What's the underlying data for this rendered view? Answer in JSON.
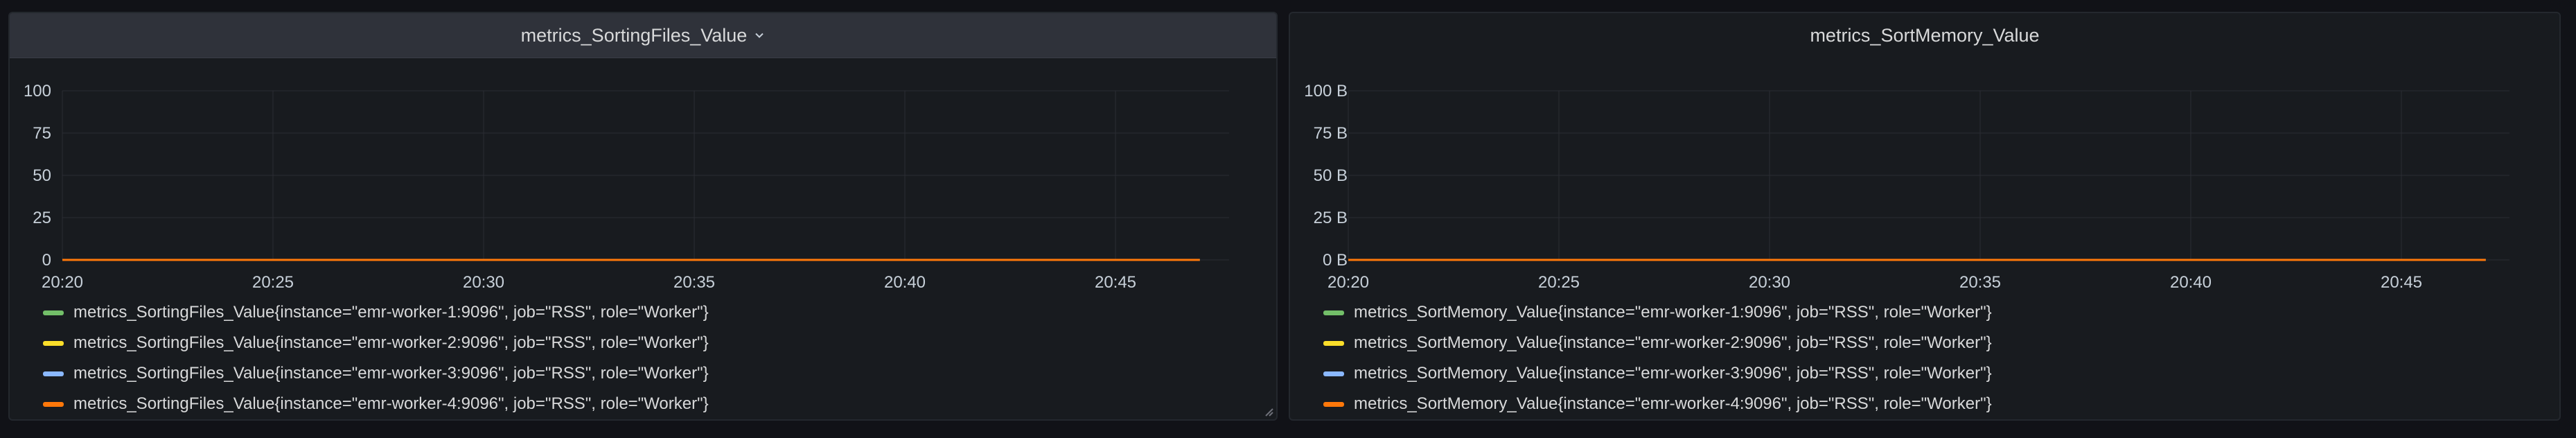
{
  "colors": {
    "background": "#111217",
    "panel": "#181b1f",
    "grid": "#2a2d33",
    "series": [
      "#73bf69",
      "#fade2a",
      "#8ab8ff",
      "#ff780a"
    ]
  },
  "panels": [
    {
      "title": "metrics_SortingFiles_Value",
      "has_menu": true,
      "legend": [
        "metrics_SortingFiles_Value{instance=\"emr-worker-1:9096\", job=\"RSS\", role=\"Worker\"}",
        "metrics_SortingFiles_Value{instance=\"emr-worker-2:9096\", job=\"RSS\", role=\"Worker\"}",
        "metrics_SortingFiles_Value{instance=\"emr-worker-3:9096\", job=\"RSS\", role=\"Worker\"}",
        "metrics_SortingFiles_Value{instance=\"emr-worker-4:9096\", job=\"RSS\", role=\"Worker\"}"
      ]
    },
    {
      "title": "metrics_SortMemory_Value",
      "has_menu": false,
      "legend": [
        "metrics_SortMemory_Value{instance=\"emr-worker-1:9096\", job=\"RSS\", role=\"Worker\"}",
        "metrics_SortMemory_Value{instance=\"emr-worker-2:9096\", job=\"RSS\", role=\"Worker\"}",
        "metrics_SortMemory_Value{instance=\"emr-worker-3:9096\", job=\"RSS\", role=\"Worker\"}",
        "metrics_SortMemory_Value{instance=\"emr-worker-4:9096\", job=\"RSS\", role=\"Worker\"}"
      ]
    }
  ],
  "chart_data": [
    {
      "type": "line",
      "title": "metrics_SortingFiles_Value",
      "x_ticks": [
        "20:20",
        "20:25",
        "20:30",
        "20:35",
        "20:40",
        "20:45"
      ],
      "y_ticks": [
        "0",
        "25",
        "50",
        "75",
        "100"
      ],
      "ylim": [
        0,
        100
      ],
      "grid": true,
      "legend_position": "bottom",
      "x": [
        "20:20",
        "20:47"
      ],
      "series": [
        {
          "name": "metrics_SortingFiles_Value{instance=\"emr-worker-1:9096\", job=\"RSS\", role=\"Worker\"}",
          "values": [
            0,
            0
          ]
        },
        {
          "name": "metrics_SortingFiles_Value{instance=\"emr-worker-2:9096\", job=\"RSS\", role=\"Worker\"}",
          "values": [
            0,
            0
          ]
        },
        {
          "name": "metrics_SortingFiles_Value{instance=\"emr-worker-3:9096\", job=\"RSS\", role=\"Worker\"}",
          "values": [
            0,
            0
          ]
        },
        {
          "name": "metrics_SortingFiles_Value{instance=\"emr-worker-4:9096\", job=\"RSS\", role=\"Worker\"}",
          "values": [
            0,
            0
          ]
        }
      ]
    },
    {
      "type": "line",
      "title": "metrics_SortMemory_Value",
      "x_ticks": [
        "20:20",
        "20:25",
        "20:30",
        "20:35",
        "20:40",
        "20:45"
      ],
      "y_ticks": [
        "0 B",
        "25 B",
        "50 B",
        "75 B",
        "100 B"
      ],
      "ylim": [
        0,
        100
      ],
      "grid": true,
      "legend_position": "bottom",
      "x": [
        "20:20",
        "20:47"
      ],
      "series": [
        {
          "name": "metrics_SortMemory_Value{instance=\"emr-worker-1:9096\", job=\"RSS\", role=\"Worker\"}",
          "values": [
            0,
            0
          ]
        },
        {
          "name": "metrics_SortMemory_Value{instance=\"emr-worker-2:9096\", job=\"RSS\", role=\"Worker\"}",
          "values": [
            0,
            0
          ]
        },
        {
          "name": "metrics_SortMemory_Value{instance=\"emr-worker-3:9096\", job=\"RSS\", role=\"Worker\"}",
          "values": [
            0,
            0
          ]
        },
        {
          "name": "metrics_SortMemory_Value{instance=\"emr-worker-4:9096\", job=\"RSS\", role=\"Worker\"}",
          "values": [
            0,
            0
          ]
        }
      ]
    }
  ]
}
